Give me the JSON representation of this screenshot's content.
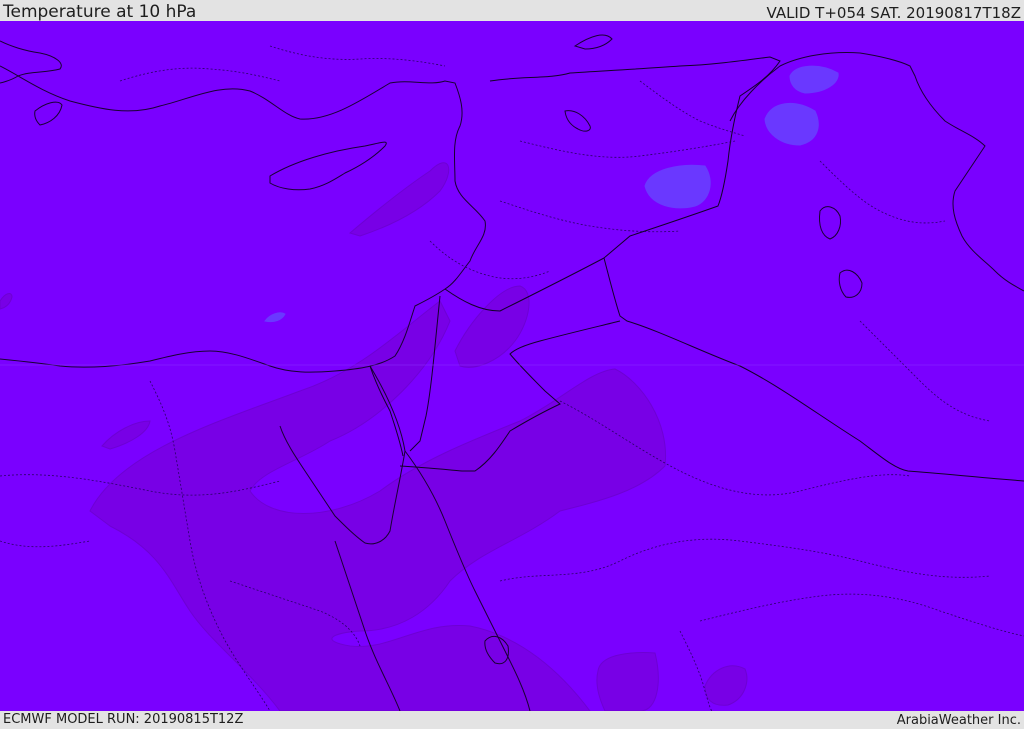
{
  "header": {
    "title": "Temperature at 10 hPa",
    "valid": "VALID T+054 SAT. 20190817T18Z"
  },
  "footer": {
    "model_run": "ECMWF MODEL RUN: 20190815T12Z",
    "credit": "ArabiaWeather Inc."
  },
  "colors": {
    "background_field": "#7a00ff",
    "warm_shade": "#7a00e0",
    "cold_shade": "#6a38ff",
    "border_line": "#1a0033",
    "panel": "#e3e3e3"
  }
}
